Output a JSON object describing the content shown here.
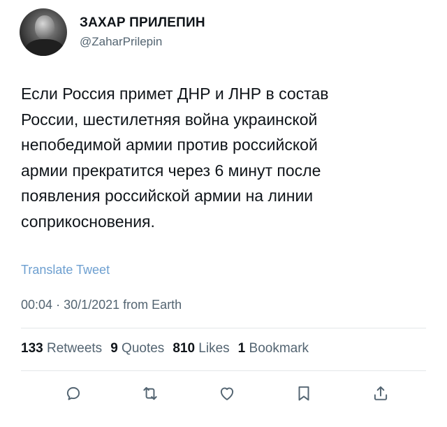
{
  "author": {
    "display_name": "ЗАХАР ПРИЛЕПИН",
    "handle": "@ZaharPrilepin"
  },
  "tweet": {
    "text": "Если Россия примет ДНР и ЛНР в состав\nРоссии, шестилетняя война украинской\nнепобедимой армии против российской\nармии прекратится через 6 минут после\nпоявления российской армии на линии\nсоприкосновения.",
    "translate_label": "Translate Tweet",
    "time": "00:04",
    "separator": "·",
    "date": "30/1/2021",
    "source": "from Earth"
  },
  "stats": {
    "retweets": {
      "count": "133",
      "label": "Retweets"
    },
    "quotes": {
      "count": "9",
      "label": "Quotes"
    },
    "likes": {
      "count": "810",
      "label": "Likes"
    },
    "bookmarks": {
      "count": "1",
      "label": "Bookmark"
    }
  },
  "actions": {
    "icons": [
      "reply-icon",
      "retweet-icon",
      "like-icon",
      "bookmark-icon",
      "share-icon"
    ]
  },
  "colors": {
    "text": "#0f1419",
    "secondary": "#536471",
    "link": "#6d9fd0",
    "divider": "#e3e6e8"
  }
}
